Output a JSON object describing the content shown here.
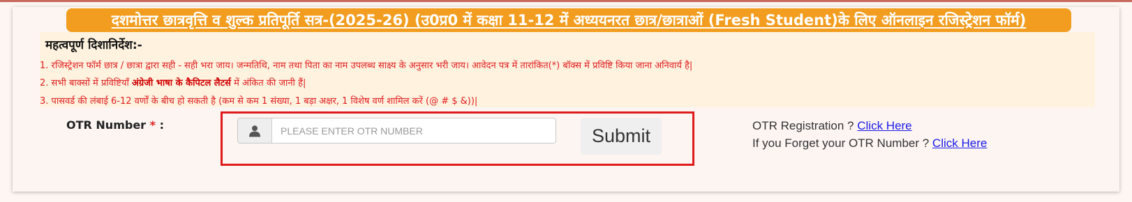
{
  "banner": {
    "title": "दशमोत्तर छात्रवृत्ति व शुल्क प्रतिपूर्ति सत्र-(2025-26) (उ0प्र0 में कक्षा 11-12 में अध्ययनरत छात्र/छात्राओं (Fresh Student)के लिए ऑनलाइन रजिस्ट्रेशन फॉर्म)"
  },
  "guidelines": {
    "title": "महत्वपूर्ण दिशानिर्देश:-",
    "item1": "1. रजिस्ट्रेशन फॉर्म छात्र / छात्रा द्वारा सही - सही भरा जाय। जन्मतिथि, नाम तथा पिता का नाम उपलब्ध साक्ष्य के अनुसार भरी जाय। आवेदन पत्र में तारांकित(*) बॉक्स में प्रविष्टि किया जाना अनिवार्य है|",
    "item2_pre": "2. सभी बाक्सों में प्रविष्टियाँ ",
    "item2_bold": "अंग्रेजी भाषा के कैपिटल लैटर्स",
    "item2_post": " में अंकित की जानी हैं|",
    "item3": "3. पासवर्ड की लंबाई 6-12 वर्णों के बीच हो सकती है (कम से कम 1 संख्या, 1 बड़ा अक्षर, 1 विशेष वर्ण शामिल करें (@ # $ &))|"
  },
  "form": {
    "otr_label": "OTR Number",
    "required_mark": "*",
    "label_suffix": " :",
    "otr_placeholder": "PLEASE ENTER OTR NUMBER",
    "otr_value": "",
    "user_icon": "user-icon",
    "submit_label": "Submit"
  },
  "links": {
    "registration_text": "OTR Registration ? ",
    "registration_link": "Click Here",
    "forgot_text": "If you Forget your OTR Number ? ",
    "forgot_link": "Click Here"
  },
  "colors": {
    "banner_bg": "#f29d1f",
    "guideline_text": "#e02020",
    "highlight_border": "#e01a1a",
    "link": "#1a1ae6"
  }
}
